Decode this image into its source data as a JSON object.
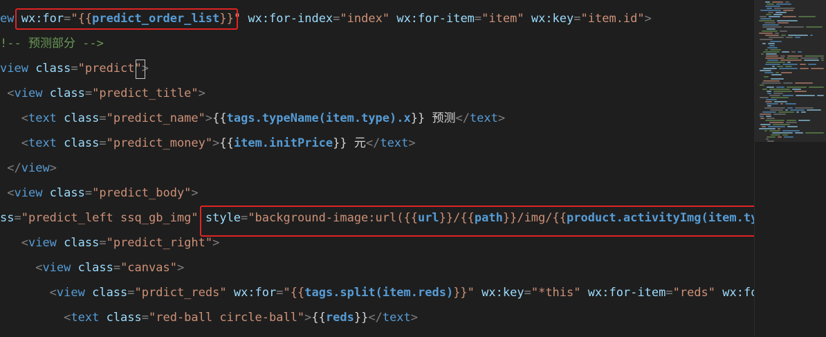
{
  "code_lines": [
    [
      [
        "t-tag",
        "ew "
      ],
      [
        "t-attr",
        "wx:for"
      ],
      [
        "t-punc",
        "="
      ],
      [
        "t-str",
        "\""
      ],
      [
        "t-brace",
        "{{"
      ],
      [
        "t-expr",
        "predict_order_list"
      ],
      [
        "t-brace",
        "}}"
      ],
      [
        "t-str",
        "\""
      ],
      [
        "t-text",
        " "
      ],
      [
        "t-attr",
        "wx:for-index"
      ],
      [
        "t-punc",
        "="
      ],
      [
        "t-str",
        "\"index\""
      ],
      [
        "t-text",
        " "
      ],
      [
        "t-attr",
        "wx:for-item"
      ],
      [
        "t-punc",
        "="
      ],
      [
        "t-str",
        "\"item\""
      ],
      [
        "t-text",
        " "
      ],
      [
        "t-attr",
        "wx:key"
      ],
      [
        "t-punc",
        "="
      ],
      [
        "t-str",
        "\"item.id\""
      ],
      [
        "t-punc",
        ">"
      ]
    ],
    [
      [
        "t-com",
        "!-- 预测部分 -->"
      ]
    ],
    [
      [
        "t-tag",
        "view "
      ],
      [
        "t-attr",
        "class"
      ],
      [
        "t-punc",
        "="
      ],
      [
        "t-str",
        "\"predict\""
      ],
      [
        "t-punc",
        ">"
      ]
    ],
    [
      [
        "t-text",
        " "
      ],
      [
        "t-punc",
        "<"
      ],
      [
        "t-tag",
        "view "
      ],
      [
        "t-attr",
        "class"
      ],
      [
        "t-punc",
        "="
      ],
      [
        "t-str",
        "\"predict_title\""
      ],
      [
        "t-punc",
        ">"
      ]
    ],
    [
      [
        "t-text",
        "   "
      ],
      [
        "t-punc",
        "<"
      ],
      [
        "t-tag",
        "text "
      ],
      [
        "t-attr",
        "class"
      ],
      [
        "t-punc",
        "="
      ],
      [
        "t-str",
        "\"predict_name\""
      ],
      [
        "t-punc",
        ">"
      ],
      [
        "t-text",
        "{{"
      ],
      [
        "t-expr",
        "tags.typeName(item.type).x"
      ],
      [
        "t-text",
        "}} 预测"
      ],
      [
        "t-punc",
        "</"
      ],
      [
        "t-tag",
        "text"
      ],
      [
        "t-punc",
        ">"
      ]
    ],
    [
      [
        "t-text",
        "   "
      ],
      [
        "t-punc",
        "<"
      ],
      [
        "t-tag",
        "text "
      ],
      [
        "t-attr",
        "class"
      ],
      [
        "t-punc",
        "="
      ],
      [
        "t-str",
        "\"predict_money\""
      ],
      [
        "t-punc",
        ">"
      ],
      [
        "t-text",
        "{{"
      ],
      [
        "t-expr",
        "item.initPrice"
      ],
      [
        "t-text",
        "}} 元"
      ],
      [
        "t-punc",
        "</"
      ],
      [
        "t-tag",
        "text"
      ],
      [
        "t-punc",
        ">"
      ]
    ],
    [
      [
        "t-text",
        " "
      ],
      [
        "t-punc",
        "</"
      ],
      [
        "t-tag",
        "view"
      ],
      [
        "t-punc",
        ">"
      ]
    ],
    [
      [
        "t-text",
        " "
      ],
      [
        "t-punc",
        "<"
      ],
      [
        "t-tag",
        "view "
      ],
      [
        "t-attr",
        "class"
      ],
      [
        "t-punc",
        "="
      ],
      [
        "t-str",
        "\"predict_body\""
      ],
      [
        "t-punc",
        ">"
      ]
    ],
    [
      [
        "t-attr",
        "ss"
      ],
      [
        "t-punc",
        "="
      ],
      [
        "t-str",
        "\"predict_left ssq_gb_img\""
      ],
      [
        "t-text",
        " "
      ],
      [
        "t-attr",
        "style"
      ],
      [
        "t-punc",
        "="
      ],
      [
        "t-str",
        "\"background-image:url("
      ],
      [
        "t-brace",
        "{{"
      ],
      [
        "t-expr",
        "url"
      ],
      [
        "t-brace",
        "}}"
      ],
      [
        "t-str",
        "/"
      ],
      [
        "t-brace",
        "{{"
      ],
      [
        "t-expr",
        "path"
      ],
      [
        "t-brace",
        "}}"
      ],
      [
        "t-str",
        "/img/"
      ],
      [
        "t-brace",
        "{{"
      ],
      [
        "t-expr",
        "product.activityImg(item.type)"
      ]
    ],
    [
      [
        "t-text",
        "   "
      ],
      [
        "t-punc",
        "<"
      ],
      [
        "t-tag",
        "view "
      ],
      [
        "t-attr",
        "class"
      ],
      [
        "t-punc",
        "="
      ],
      [
        "t-str",
        "\"predict_right\""
      ],
      [
        "t-punc",
        ">"
      ]
    ],
    [
      [
        "t-text",
        "     "
      ],
      [
        "t-punc",
        "<"
      ],
      [
        "t-tag",
        "view "
      ],
      [
        "t-attr",
        "class"
      ],
      [
        "t-punc",
        "="
      ],
      [
        "t-str",
        "\"canvas\""
      ],
      [
        "t-punc",
        ">"
      ]
    ],
    [
      [
        "t-text",
        "       "
      ],
      [
        "t-punc",
        "<"
      ],
      [
        "t-tag",
        "view "
      ],
      [
        "t-attr",
        "class"
      ],
      [
        "t-punc",
        "="
      ],
      [
        "t-str",
        "\"prdict_reds\""
      ],
      [
        "t-text",
        " "
      ],
      [
        "t-attr",
        "wx:for"
      ],
      [
        "t-punc",
        "="
      ],
      [
        "t-str",
        "\""
      ],
      [
        "t-brace",
        "{{"
      ],
      [
        "t-expr",
        "tags.split(item.reds)"
      ],
      [
        "t-brace",
        "}}"
      ],
      [
        "t-str",
        "\""
      ],
      [
        "t-text",
        " "
      ],
      [
        "t-attr",
        "wx:key"
      ],
      [
        "t-punc",
        "="
      ],
      [
        "t-str",
        "\"*this\""
      ],
      [
        "t-text",
        " "
      ],
      [
        "t-attr",
        "wx:for-item"
      ],
      [
        "t-punc",
        "="
      ],
      [
        "t-str",
        "\"reds\""
      ],
      [
        "t-text",
        " "
      ],
      [
        "t-attr",
        "wx:for-i"
      ]
    ],
    [
      [
        "t-text",
        "         "
      ],
      [
        "t-punc",
        "<"
      ],
      [
        "t-tag",
        "text "
      ],
      [
        "t-attr",
        "class"
      ],
      [
        "t-punc",
        "="
      ],
      [
        "t-str",
        "\"red-ball circle-ball\""
      ],
      [
        "t-punc",
        ">"
      ],
      [
        "t-text",
        "{{"
      ],
      [
        "t-expr",
        "reds"
      ],
      [
        "t-text",
        "}}"
      ],
      [
        "t-punc",
        "</"
      ],
      [
        "t-tag",
        "text"
      ],
      [
        "t-punc",
        ">"
      ]
    ]
  ],
  "colors": {
    "background": "#1e1e1e",
    "tag": "#569cd6",
    "attribute": "#9cdcfe",
    "string": "#ce9178",
    "comment": "#6a9955",
    "highlight_box": "#e02424"
  }
}
